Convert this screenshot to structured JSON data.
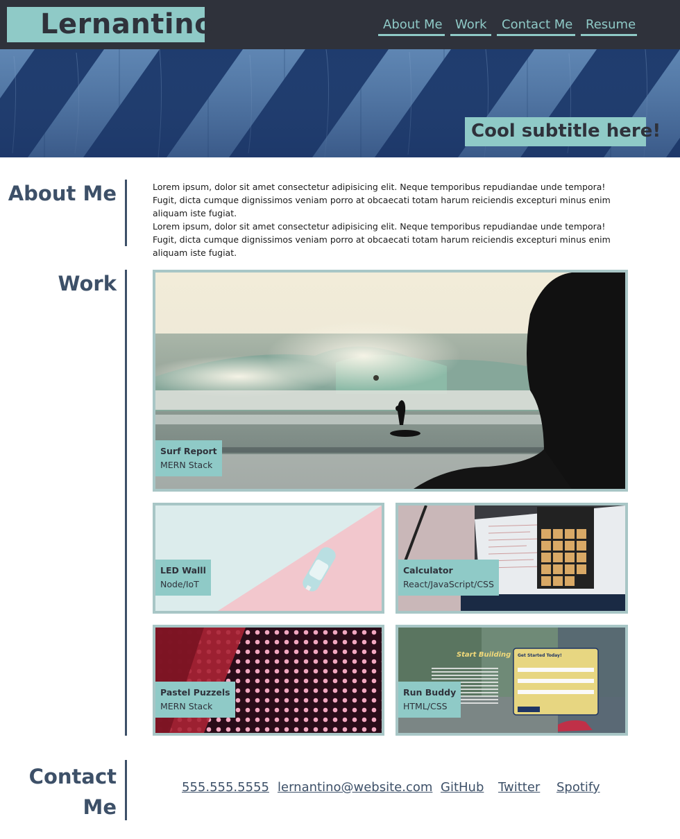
{
  "header": {
    "logo": "Lernantino",
    "nav": [
      {
        "label": "About Me",
        "name": "nav-about-me"
      },
      {
        "label": "Work",
        "name": "nav-work"
      },
      {
        "label": "Contact Me",
        "name": "nav-contact-me"
      },
      {
        "label": "Resume",
        "name": "nav-resume"
      }
    ]
  },
  "hero": {
    "subtitle": "Cool subtitle here!"
  },
  "about": {
    "title": "About Me",
    "paragraphs": [
      "Lorem ipsum, dolor sit amet consectetur adipisicing elit. Neque temporibus repudiandae unde tempora! Fugit, dicta cumque dignissimos veniam porro at obcaecati totam harum reiciendis excepturi minus enim aliquam iste fugiat.",
      "Lorem ipsum, dolor sit amet consectetur adipisicing elit. Neque temporibus repudiandae unde tempora! Fugit, dicta cumque dignissimos veniam porro at obcaecati totam harum reiciendis excepturi minus enim aliquam iste fugiat."
    ]
  },
  "work": {
    "title": "Work",
    "projects": [
      {
        "title": "Surf Report",
        "stack": "MERN Stack"
      },
      {
        "title": "LED Walll",
        "stack": "Node/IoT"
      },
      {
        "title": "Calculator",
        "stack": "React/JavaScript/CSS"
      },
      {
        "title": "Pastel Puzzels",
        "stack": "MERN Stack"
      },
      {
        "title": "Run Buddy",
        "stack": "HTML/CSS"
      }
    ],
    "run_buddy_screenshot": {
      "heading": "Start Building Habits.",
      "form_title": "Get Started Today!"
    }
  },
  "contact": {
    "title_line1": "Contact",
    "title_line2": "Me",
    "links": [
      {
        "label": "555.555.5555",
        "name": "contact-phone-link"
      },
      {
        "label": "lernantino@website.com",
        "name": "contact-email-link"
      },
      {
        "label": "GitHub",
        "name": "contact-github-link"
      },
      {
        "label": "Twitter",
        "name": "contact-twitter-link"
      },
      {
        "label": "Spotify",
        "name": "contact-spotify-link"
      }
    ]
  },
  "colors": {
    "header_bg": "#2f323b",
    "accent": "#8fcac7",
    "section_title": "#3d5068",
    "card_border": "#a8c6c6"
  }
}
